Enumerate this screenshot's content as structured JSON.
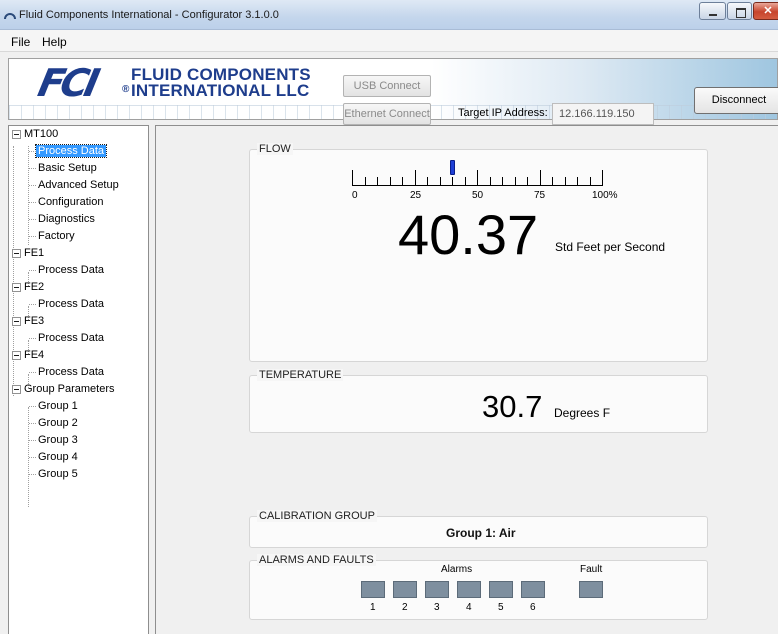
{
  "window": {
    "title": "Fluid Components International - Configurator 3.1.0.0",
    "minimize": "",
    "maximize": "",
    "close": "✕"
  },
  "menu": {
    "file": "File",
    "help": "Help"
  },
  "header": {
    "logo_mark": "FCI",
    "logo_line1": "FLUID COMPONENTS",
    "logo_line2": "INTERNATIONAL LLC",
    "logo_reg": "®",
    "usb_connect": "USB Connect",
    "ethernet_connect": "Ethernet Connect",
    "ip_label": "Target IP Address:",
    "ip_value": "12.166.119.150",
    "disconnect": "Disconnect"
  },
  "tree": {
    "mt100": "MT100",
    "mt100_children": [
      "Process Data",
      "Basic Setup",
      "Advanced Setup",
      "Configuration",
      "Diagnostics",
      "Factory"
    ],
    "fe1": "FE1",
    "fe2": "FE2",
    "fe3": "FE3",
    "fe4": "FE4",
    "fe_child": "Process Data",
    "group_params": "Group Parameters",
    "groups": [
      "Group 1",
      "Group 2",
      "Group 3",
      "Group 4",
      "Group 5"
    ],
    "selected": "MT100 / Process Data"
  },
  "flow": {
    "title": "FLOW",
    "scale_labels": [
      "0",
      "25",
      "50",
      "75",
      "100%"
    ],
    "percent": 40.37,
    "value": "40.37",
    "unit": "Std Feet per Second"
  },
  "temperature": {
    "title": "TEMPERATURE",
    "value": "30.7",
    "unit": "Degrees F"
  },
  "calibration": {
    "title": "CALIBRATION GROUP",
    "value": "Group 1: Air"
  },
  "alarms": {
    "title": "ALARMS AND FAULTS",
    "alarms_label": "Alarms",
    "fault_label": "Fault",
    "numbers": [
      "1",
      "2",
      "3",
      "4",
      "5",
      "6"
    ],
    "indicator_color": "#7e8f9f"
  }
}
